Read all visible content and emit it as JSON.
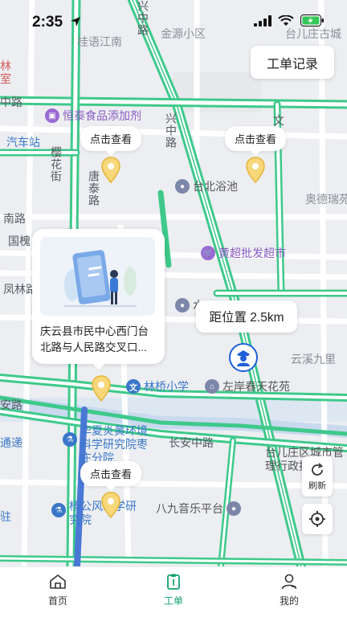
{
  "status_bar": {
    "time": "2:35"
  },
  "header": {
    "order_record_label": "工单记录"
  },
  "map": {
    "area_labels": {
      "guiyu_jiangnan": "桂语江南",
      "jinyuan": "金源小区",
      "taierzhuang_top": "台儿庄古城",
      "aode": "奥德瑞苑",
      "yunxi": "云溪九里",
      "lin": "林",
      "shi": "室",
      "car_station": "汽车站",
      "jie": "街",
      "tong": "通递",
      "zhu": "驻"
    },
    "road_labels": {
      "xingzhong_top": "兴中路",
      "xingzhong_mid": "兴中路",
      "zhong": "中路",
      "yinghua": "樱花街",
      "tangtai": "唐泰路",
      "nan": "南路",
      "guohuai": "国槐",
      "fenglin": "凤林路",
      "changan": "长安中路",
      "anlu": "安路",
      "wen": "文"
    },
    "pois": {
      "hengtai": "恒泰食品添加剂",
      "taibei_bath": "台北浴池",
      "huangchao": "黄超批发超市",
      "shui": "水",
      "linqiao_school": "林桥小学",
      "zuoan": "左岸春天花苑",
      "huaxia": "华夏炎黄环境科学研究院枣庄分院",
      "yanggong": "杨公风水学研究院",
      "bajiu_music": "八九音乐平台",
      "tz_district": "台儿庄区城市管理行政执法局",
      "sanzi": "三"
    },
    "bubbles": {
      "b1": "点击查看",
      "b2": "点击查看",
      "b3": "点击查看"
    },
    "info_card": {
      "address": "庆云县市民中心西门台北路与人民路交叉口..."
    },
    "distance": "距位置 2.5km"
  },
  "controls": {
    "refresh_label": "刷新"
  },
  "tab_bar": {
    "tabs": [
      {
        "label": "首页"
      },
      {
        "label": "工单"
      },
      {
        "label": "我的"
      }
    ]
  },
  "colors": {
    "road_green": "#3ec98b",
    "accent": "#14a36b",
    "marker_blue": "#1f5fd8",
    "pin_yellow": "#f0c14b"
  }
}
